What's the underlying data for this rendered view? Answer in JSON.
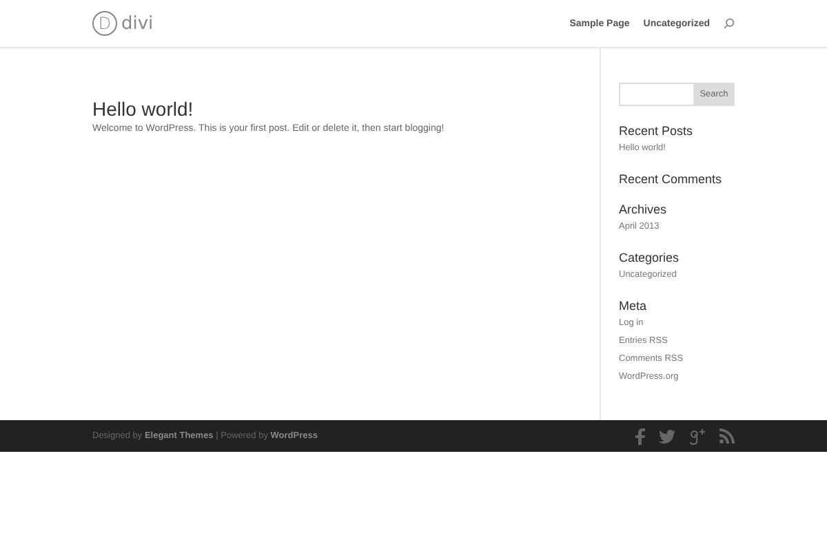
{
  "header": {
    "logo": {
      "mark": "D",
      "name": "divi"
    },
    "nav": [
      {
        "label": "Sample Page"
      },
      {
        "label": "Uncategorized"
      }
    ]
  },
  "post": {
    "title": "Hello world!",
    "excerpt": "Welcome to WordPress. This is your first post. Edit or delete it, then start blogging!"
  },
  "sidebar": {
    "search": {
      "button": "Search"
    },
    "widgets": [
      {
        "title": "Recent Posts",
        "links": [
          "Hello world!"
        ]
      },
      {
        "title": "Recent Comments"
      },
      {
        "title": "Archives",
        "links": [
          "April 2013"
        ]
      },
      {
        "title": "Categories",
        "links": [
          "Uncategorized"
        ]
      },
      {
        "title": "Meta",
        "links": [
          "Log in",
          "Entries RSS",
          "Comments RSS",
          "WordPress.org"
        ]
      }
    ]
  },
  "footer": {
    "credits": "Designed by **Elegant Themes** | Powered by **WordPress**",
    "social": [
      {
        "kind": "facebook"
      },
      {
        "kind": "twitter"
      },
      {
        "kind": "googleplus"
      },
      {
        "kind": "rss"
      }
    ]
  }
}
